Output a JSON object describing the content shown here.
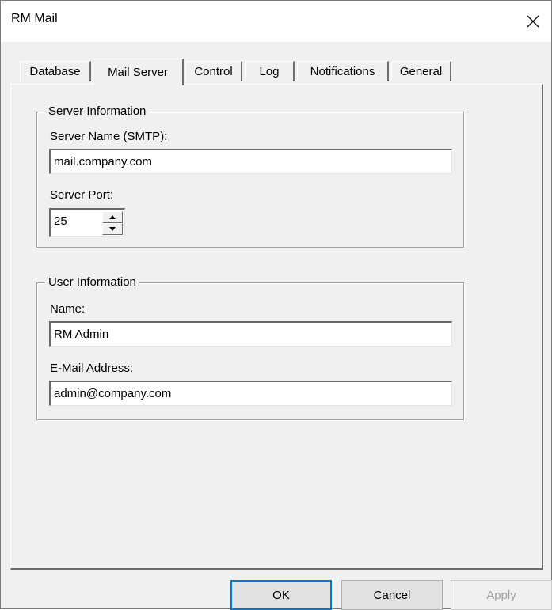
{
  "window": {
    "title": "RM Mail"
  },
  "tabs": [
    {
      "label": "Database",
      "active": false
    },
    {
      "label": "Mail Server",
      "active": true
    },
    {
      "label": "Control",
      "active": false
    },
    {
      "label": "Log",
      "active": false
    },
    {
      "label": "Notifications",
      "active": false
    },
    {
      "label": "General",
      "active": false
    }
  ],
  "server_info": {
    "legend": "Server Information",
    "server_name_label": "Server Name (SMTP):",
    "server_name_value": "mail.company.com",
    "port_label": "Server Port:",
    "port_value": "25"
  },
  "user_info": {
    "legend": "User Information",
    "name_label": "Name:",
    "name_value": "RM Admin",
    "email_label": "E-Mail Address:",
    "email_value": "admin@company.com"
  },
  "buttons": {
    "ok": "OK",
    "cancel": "Cancel",
    "apply": "Apply"
  }
}
